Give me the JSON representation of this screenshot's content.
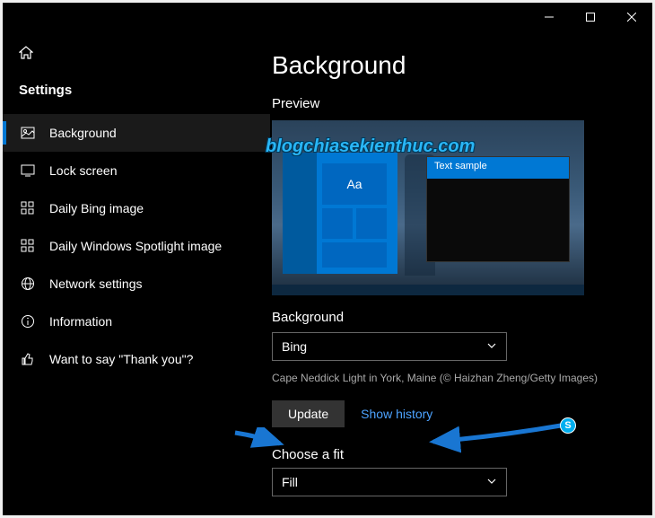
{
  "titlebar": {
    "min": "minimize",
    "max": "maximize",
    "close": "close"
  },
  "sidebar": {
    "title": "Settings",
    "items": [
      {
        "label": "Background",
        "selected": true
      },
      {
        "label": "Lock screen",
        "selected": false
      },
      {
        "label": "Daily Bing image",
        "selected": false
      },
      {
        "label": "Daily Windows Spotlight image",
        "selected": false
      },
      {
        "label": "Network settings",
        "selected": false
      },
      {
        "label": "Information",
        "selected": false
      },
      {
        "label": "Want to say \"Thank you\"?",
        "selected": false
      }
    ]
  },
  "main": {
    "title": "Background",
    "preview_label": "Preview",
    "preview_tile_text": "Aa",
    "preview_window_title": "Text sample",
    "bg_label": "Background",
    "bg_dropdown_value": "Bing",
    "bg_caption": "Cape Neddick Light in York, Maine (© Haizhan Zheng/Getty Images)",
    "update_btn": "Update",
    "history_link": "Show history",
    "fit_label": "Choose a fit",
    "fit_dropdown_value": "Fill"
  },
  "watermark": "blogchiasekienthuc.com",
  "skype_badge": "S"
}
